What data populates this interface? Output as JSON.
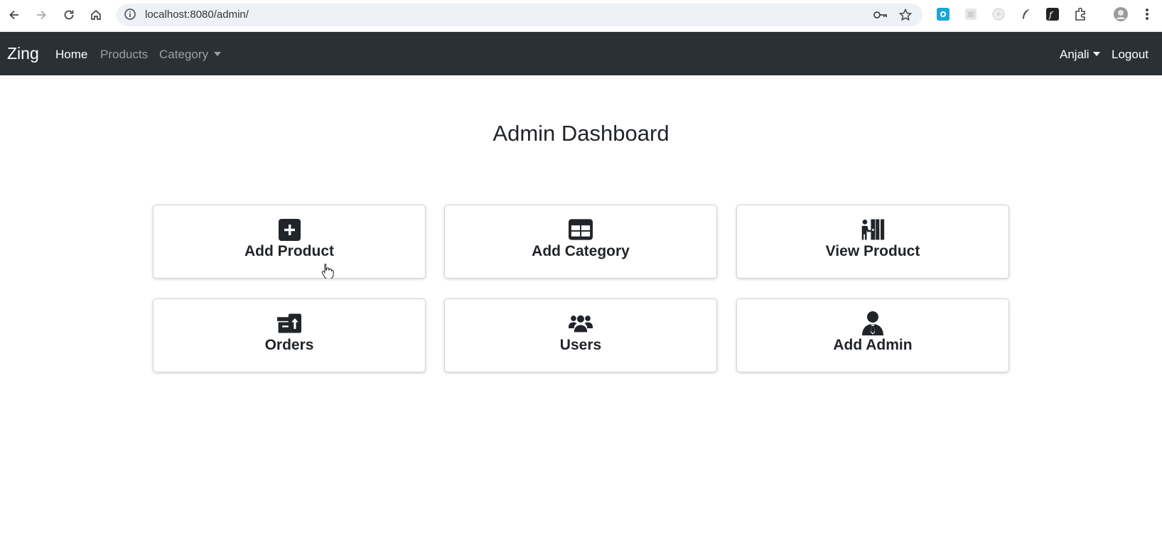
{
  "browser": {
    "url": "localhost:8080/admin/",
    "icons": [
      "back-icon",
      "forward-icon",
      "reload-icon",
      "home-icon",
      "site-info-icon",
      "password-key-icon",
      "bookmark-star-icon",
      "extension-icons",
      "profile-avatar",
      "browser-menu-icon"
    ]
  },
  "navbar": {
    "brand": "Zing",
    "links": [
      {
        "label": "Home",
        "active": true
      },
      {
        "label": "Products",
        "active": false
      },
      {
        "label": "Category",
        "active": false,
        "dropdown": true
      }
    ],
    "user": "Anjali",
    "logout": "Logout"
  },
  "main": {
    "title": "Admin Dashboard",
    "cards": [
      {
        "label": "Add Product",
        "icon": "plus-square-icon"
      },
      {
        "label": "Add Category",
        "icon": "table-grid-icon"
      },
      {
        "label": "View Product",
        "icon": "person-shelf-icon"
      },
      {
        "label": "Orders",
        "icon": "archive-box-icon"
      },
      {
        "label": "Users",
        "icon": "users-group-icon"
      },
      {
        "label": "Add Admin",
        "icon": "admin-person-icon"
      }
    ]
  },
  "colors": {
    "navbar_bg": "#2b3035",
    "nav_active": "#ffffff",
    "nav_inactive": "#9aa0a6",
    "text_dark": "#212529"
  }
}
